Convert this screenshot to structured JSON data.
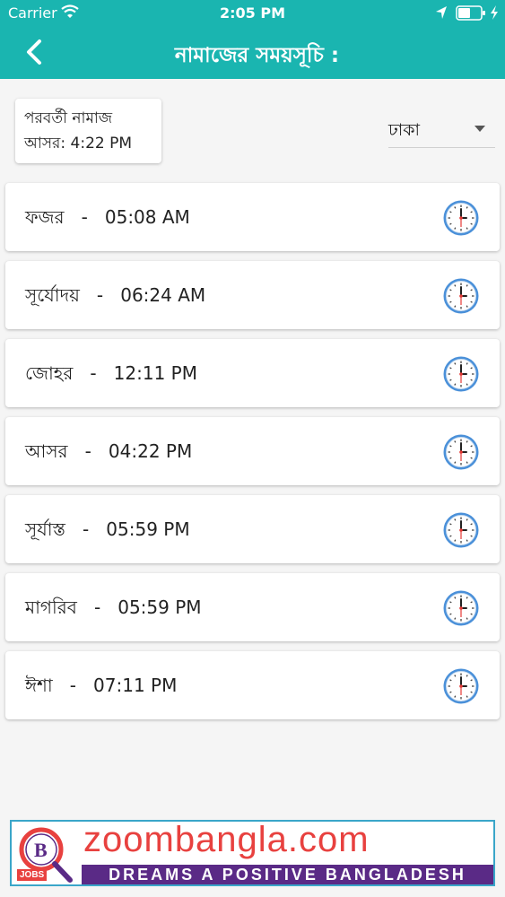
{
  "status_bar": {
    "carrier": "Carrier",
    "time": "2:05 PM"
  },
  "nav": {
    "title": "নামাজের সময়সূচি :"
  },
  "next_prayer": {
    "heading": "পরবর্তী নামাজ",
    "value": "আসর: 4:22 PM"
  },
  "city_select": {
    "selected": "ঢাকা"
  },
  "prayers": [
    {
      "label": "ফজর   -   05:08 AM"
    },
    {
      "label": "সূর্যোদয়   -   06:24 AM"
    },
    {
      "label": "জোহর   -   12:11 PM"
    },
    {
      "label": "আসর   -   04:22 PM"
    },
    {
      "label": "সূর্যাস্ত   -   05:59 PM"
    },
    {
      "label": "মাগরিব   -   05:59 PM"
    },
    {
      "label": "ঈশা   -   07:11 PM"
    }
  ],
  "banner": {
    "brand": "zoombangla.com",
    "tagline": "DREAMS A POSITIVE BANGLADESH",
    "badge": "JOBS"
  },
  "colors": {
    "header": "#1ab5b0",
    "brand": "#e8413f",
    "tagline_bg": "#5a2a86"
  }
}
